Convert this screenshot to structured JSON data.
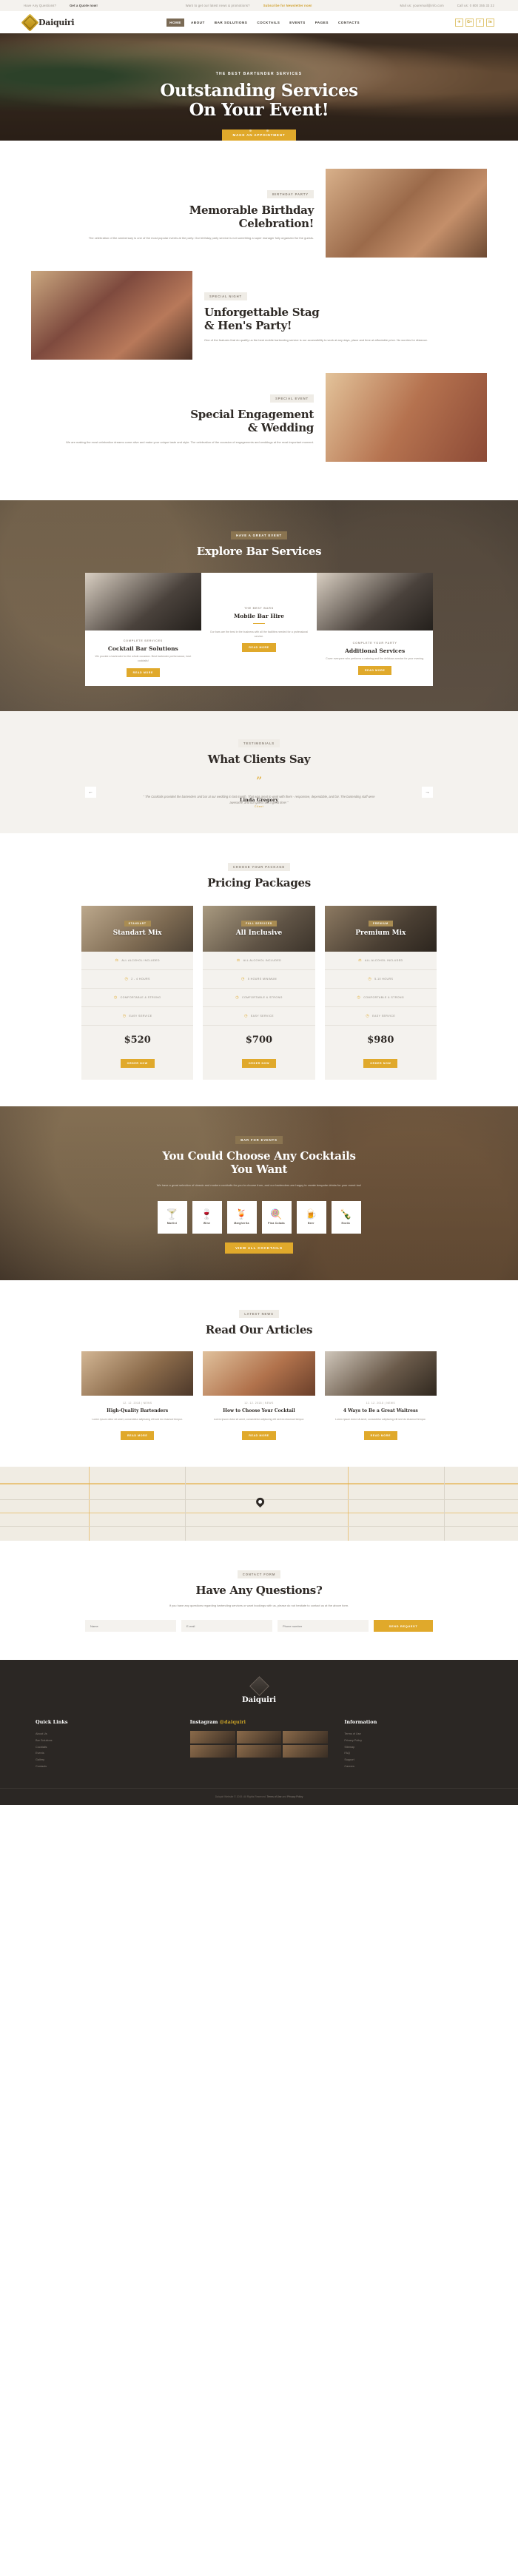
{
  "topbar": {
    "left_text": "Have Any Questions?",
    "left_link": "Get a Quote now!",
    "mid_text": "Want to get our latest news & promotions?",
    "mid_link": "Subscribe for Newsletter now!",
    "mail": "Mail us: youremail@info.com",
    "phone": "Call us: 0 800 355 33 22"
  },
  "header": {
    "brand": "Daiquiri",
    "nav": [
      {
        "label": "HOME",
        "active": true
      },
      {
        "label": "ABOUT",
        "active": false
      },
      {
        "label": "BAR SOLUTIONS",
        "active": false
      },
      {
        "label": "COCKTAILS",
        "active": false
      },
      {
        "label": "EVENTS",
        "active": false
      },
      {
        "label": "PAGES",
        "active": false
      },
      {
        "label": "CONTACTS",
        "active": false
      }
    ],
    "social": [
      {
        "name": "twitter-icon",
        "glyph": "✈"
      },
      {
        "name": "google-plus-icon",
        "glyph": "G+"
      },
      {
        "name": "facebook-icon",
        "glyph": "f"
      },
      {
        "name": "linkedin-icon",
        "glyph": "in"
      }
    ]
  },
  "hero": {
    "eyebrow": "THE BEST BARTENDER SERVICES",
    "title_line1": "Outstanding Services",
    "title_line2": "On Your Event!",
    "cta": "MAKE AN APPOINTMENT",
    "slides": 3,
    "active_slide": 1
  },
  "about": [
    {
      "label": "BIRTHDAY PARTY",
      "title_line1": "Memorable Birthday",
      "title_line2": "Celebration!",
      "text": "The celebration of the anniversary is one of the most popular events at the party. Our birthday party service is not something a super manager fully organized for the guests."
    },
    {
      "label": "SPECIAL NIGHT",
      "title_line1": "Unforgettable Stag",
      "title_line2": "& Hen's Party!",
      "text": "One of the features that do qualify us the best mobile bartending service is our accessibility to work at any days, place and time at affordable price. No worries for distance."
    },
    {
      "label": "SPECIAL EVENT",
      "title_line1": "Special Engagement",
      "title_line2": "& Wedding",
      "text": "We are making the most celebration dreams come alive and make your unique taste and style. The celebration of the occasion of engagements and weddings at the most important moment."
    }
  ],
  "services": {
    "label": "HAVE A GREAT EVENT",
    "title": "Explore Bar Services",
    "featured": {
      "sub": "THE BEST BARS",
      "title": "Mobile Bar Hire",
      "text": "Our bars are the best in the business with all the facilities needed for a professional service.",
      "cta": "READ MORE"
    },
    "cards": [
      {
        "sub": "COMPLETE SERVICES",
        "title": "Cocktail Bar Solutions",
        "text": "We provide a bartender for the whole occasion. Best bartender performance, best cocktails!",
        "cta": "READ MORE"
      },
      {
        "sub": "COMPLETE YOUR PARTY",
        "title": "Additional Services",
        "text": "Cover everyone who performs a catering and the delicious service for your evening.",
        "cta": "READ MORE"
      }
    ]
  },
  "testimonials": {
    "label": "TESTIMONIALS",
    "title": "What Clients Say",
    "quote": "“ The Cocktails provided the bartenders and bar at our wedding in last month. That was great to work with them - responsive, dependable, and fair. The bartending staff were awesome, and our guest had a great time! ”",
    "author": "Linda Gregory",
    "role": "Client",
    "prev": "←",
    "next": "→"
  },
  "pricing": {
    "label": "CHOOSE YOUR PACKAGE",
    "title": "Pricing Packages",
    "plans": [
      {
        "tag": "STANDART",
        "name": "Standart Mix",
        "features": [
          "ALL ALCOHOL INCLUDED",
          "2 - 4 HOURS",
          "COMFORTABLE & STRONG",
          "EASY SERVICE"
        ],
        "price": "$520",
        "cta": "ORDER NOW"
      },
      {
        "tag": "FULL SERVICES",
        "name": "All Inclusive",
        "features": [
          "ALL ALCOHOL INCLUDED",
          "5 HOURS MINIMUM",
          "COMFORTABLE & STRONG",
          "EASY SERVICE"
        ],
        "price": "$700",
        "cta": "ORDER NOW"
      },
      {
        "tag": "PREMIUM",
        "name": "Premium Mix",
        "features": [
          "ALL ALCOHOL INCLUDED",
          "5-10 HOURS",
          "COMFORTABLE & STRONG",
          "EASY SERVICE"
        ],
        "price": "$980",
        "cta": "ORDER NOW"
      }
    ]
  },
  "cocktails": {
    "label": "BAR FOR EVENTS",
    "title_line1": "You Could Choose Any Cocktails",
    "title_line2": "You Want",
    "text": "We have a great selection of classic and modern cocktails for you to choose from, and our bartenders are happy to create bespoke drinks for your event too!",
    "tabs": [
      {
        "label": "Martini",
        "glyph": "ἷ8",
        "icon": "martini-glass-icon"
      },
      {
        "label": "Wine",
        "glyph": "ἷ7",
        "icon": "wine-glass-icon"
      },
      {
        "label": "Margherita",
        "glyph": "ἷ9",
        "icon": "margarita-glass-icon"
      },
      {
        "label": "Pina Colada",
        "glyph": "ἴD",
        "icon": "pina-colada-icon"
      },
      {
        "label": "Beer",
        "glyph": "ἷA",
        "icon": "beer-mug-icon"
      },
      {
        "label": "Exotic",
        "glyph": "ᾖ4",
        "icon": "exotic-drink-icon"
      }
    ],
    "cta": "VIEW ALL COCKTAILS"
  },
  "blog": {
    "label": "LATEST NEWS",
    "title": "Read Our Articles",
    "posts": [
      {
        "meta": "12. 12. 2018  |  NEWS",
        "title": "High-Quality Bartenders",
        "text": "Lorem ipsum dolor sit amet, consectetur adipiscing elit sed do eiusmod tempor.",
        "cta": "READ MORE"
      },
      {
        "meta": "12. 12. 2018  |  NEWS",
        "title": "How to Choose Your Cocktail",
        "text": "Lorem ipsum dolor sit amet, consectetur adipiscing elit sed do eiusmod tempor.",
        "cta": "READ MORE"
      },
      {
        "meta": "12. 12. 2018  |  NEWS",
        "title": "4 Ways to Be a Great Waitress",
        "text": "Lorem ipsum dolor sit amet, consectetur adipiscing elit sed do eiusmod tempor.",
        "cta": "READ MORE"
      }
    ]
  },
  "contact": {
    "label": "CONTACT FORM",
    "title": "Have Any Questions?",
    "text": "If you have any questions regarding bartending services or want bookings with us, please do not hesitate to contact us at the above form.",
    "fields": [
      {
        "placeholder": "Name",
        "value": ""
      },
      {
        "placeholder": "E-mail",
        "value": ""
      },
      {
        "placeholder": "Phone number",
        "value": ""
      }
    ],
    "submit": "SEND REQUEST"
  },
  "footer": {
    "brand": "Daiquiri",
    "columns": [
      {
        "heading": "Quick Links",
        "items": [
          "About Us",
          "Bar Solutions",
          "Cocktails",
          "Events",
          "Gallery",
          "Contacts"
        ]
      },
      {
        "heading_prefix": "Instagram",
        "heading_brand": "@daiquiri",
        "items": []
      },
      {
        "heading": "Information",
        "items": [
          "Terms of Use",
          "Privacy Policy",
          "Sitemap",
          "FAQ",
          "Support",
          "Careers"
        ]
      }
    ],
    "copyright": "Daiquiri Website © 2019. All Rights Reserved.",
    "terms": "Terms of Use",
    "and": "and",
    "privacy": "Privacy Policy"
  }
}
